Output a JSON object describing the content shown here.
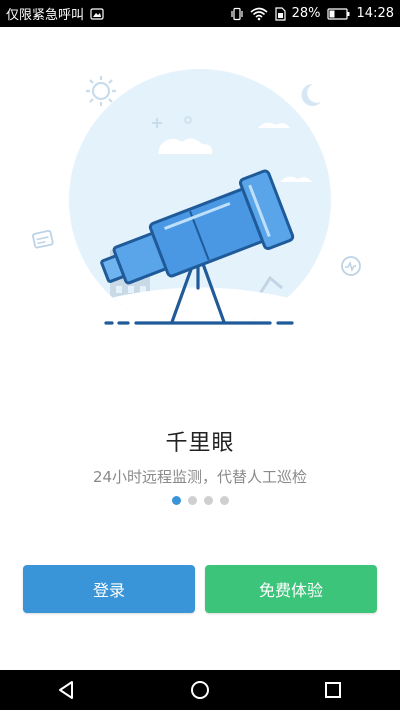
{
  "status_bar": {
    "carrier_text": "仅限紧急呼叫",
    "battery_percent": "28%",
    "time": "14:28",
    "icons": [
      "screenshot-notification-icon",
      "vibrate-icon",
      "wifi-icon",
      "sim-icon",
      "battery-icon"
    ]
  },
  "onboarding": {
    "title": "千里眼",
    "subtitle": "24小时远程监测，代替人工巡检",
    "pages_total": 4,
    "current_page": 1,
    "illustration_icon": "telescope-illustration"
  },
  "actions": {
    "login_label": "登录",
    "trial_label": "免费体验"
  },
  "navigation_bar": {
    "icons": [
      "back-icon",
      "home-icon",
      "recents-icon"
    ]
  },
  "colors": {
    "primary": "#3a95d8",
    "success": "#3cc47a",
    "illustration_bg": "#e4f2fc",
    "illustration_stroke": "#1f5a99"
  }
}
